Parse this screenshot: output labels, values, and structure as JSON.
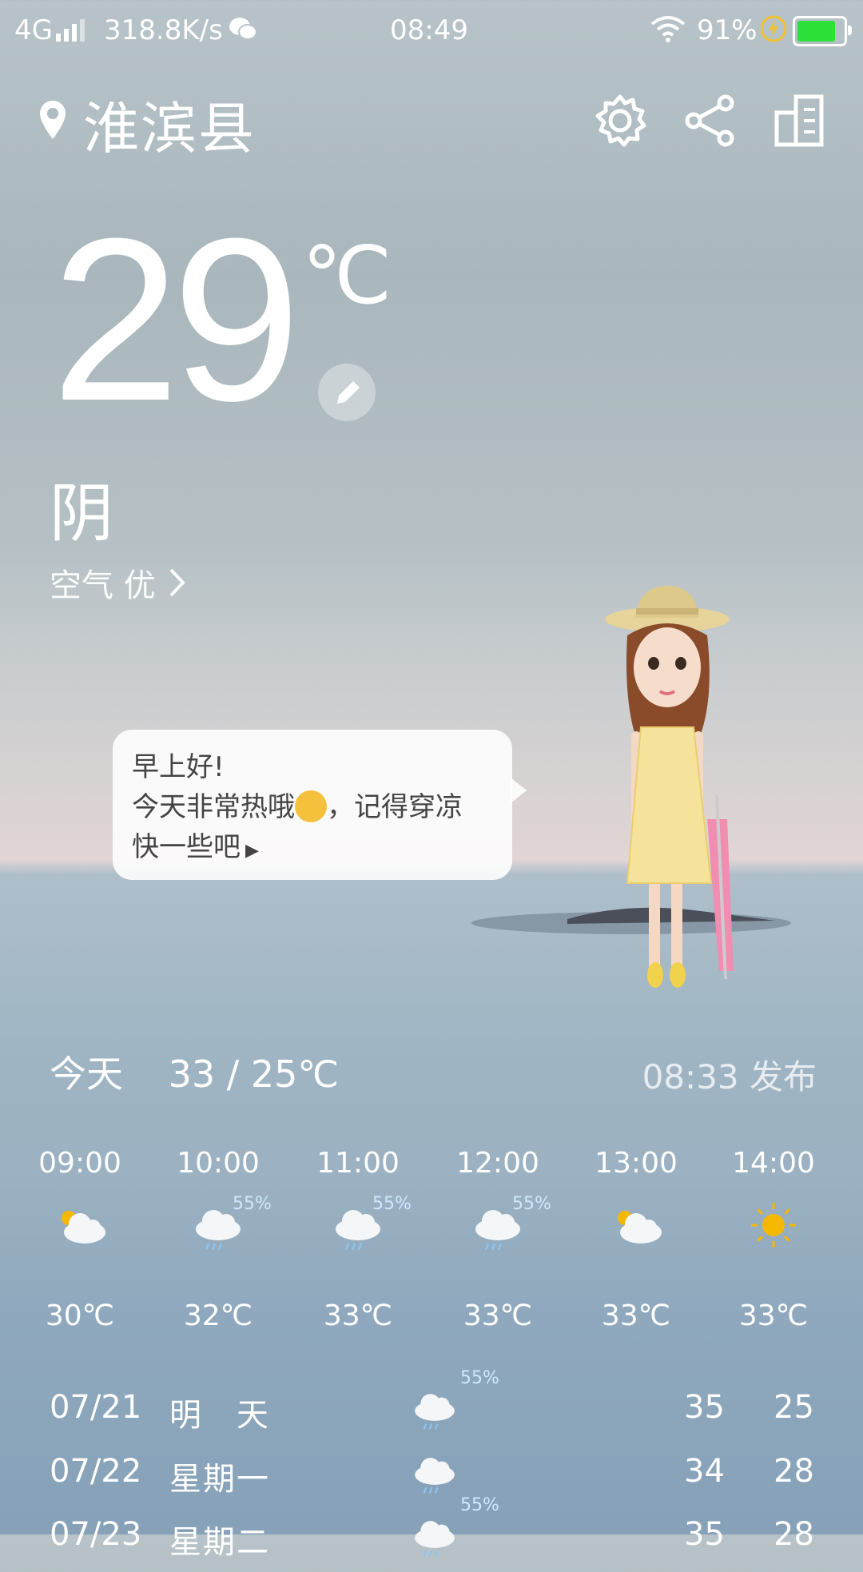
{
  "status": {
    "network": "4G",
    "speed": "318.8K/s",
    "time": "08:49",
    "battery_text": "91%",
    "battery_level": 0.91,
    "battery_color": "#2ee03a"
  },
  "header": {
    "location": "淮滨县",
    "icons": [
      "location-pin-icon",
      "gear-icon",
      "share-icon",
      "city-list-icon"
    ]
  },
  "current": {
    "temp": "29",
    "unit": "℃",
    "condition": "阴",
    "air_quality": "空气 优"
  },
  "bubble": {
    "line1": "早上好!",
    "line2": "今天非常热哦",
    "line2b": "，记得穿凉",
    "line3": "快一些吧"
  },
  "today": {
    "label": "今天",
    "range": "33 / 25℃",
    "published": "08:33 发布"
  },
  "hourly": [
    {
      "time": "09:00",
      "icon": "partly-cloudy-icon",
      "precip": "",
      "temp": "30℃"
    },
    {
      "time": "10:00",
      "icon": "rain-cloud-icon",
      "precip": "55%",
      "temp": "32℃"
    },
    {
      "time": "11:00",
      "icon": "rain-cloud-icon",
      "precip": "55%",
      "temp": "33℃"
    },
    {
      "time": "12:00",
      "icon": "rain-cloud-icon",
      "precip": "55%",
      "temp": "33℃"
    },
    {
      "time": "13:00",
      "icon": "partly-cloudy-icon",
      "precip": "",
      "temp": "33℃"
    },
    {
      "time": "14:00",
      "icon": "sun-icon",
      "precip": "",
      "temp": "33℃"
    }
  ],
  "daily": [
    {
      "date": "07/21",
      "weekday": "明　天",
      "icon": "rain-cloud-icon",
      "precip": "55%",
      "high": "35",
      "low": "25"
    },
    {
      "date": "07/22",
      "weekday": "星期一",
      "icon": "rain-cloud-icon",
      "precip": "",
      "high": "34",
      "low": "28"
    },
    {
      "date": "07/23",
      "weekday": "星期二",
      "icon": "rain-cloud-icon",
      "precip": "55%",
      "high": "35",
      "low": "28"
    }
  ]
}
